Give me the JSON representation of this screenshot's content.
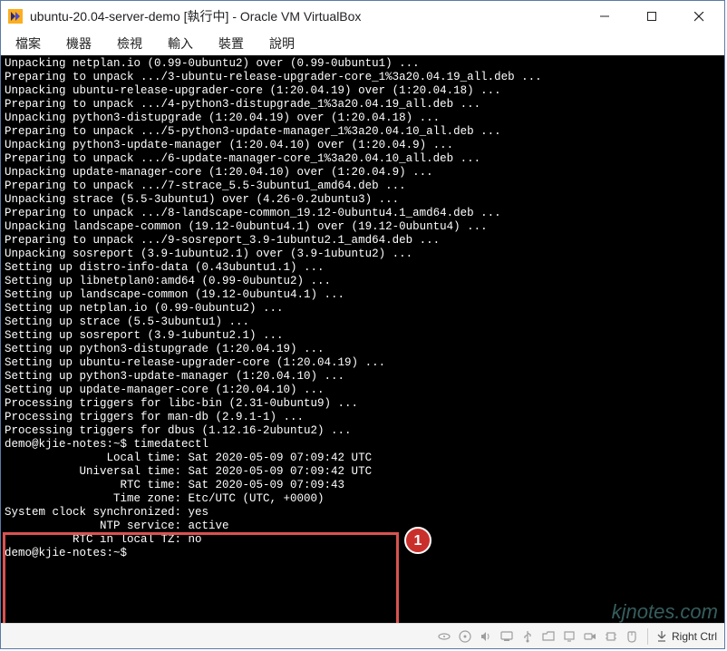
{
  "window": {
    "title": "ubuntu-20.04-server-demo [執行中] - Oracle VM VirtualBox"
  },
  "menu": {
    "file": "檔案",
    "machine": "機器",
    "view": "檢視",
    "input": "輸入",
    "devices": "裝置",
    "help": "說明"
  },
  "terminal_lines": [
    "Unpacking netplan.io (0.99-0ubuntu2) over (0.99-0ubuntu1) ...",
    "Preparing to unpack .../3-ubuntu-release-upgrader-core_1%3a20.04.19_all.deb ...",
    "Unpacking ubuntu-release-upgrader-core (1:20.04.19) over (1:20.04.18) ...",
    "Preparing to unpack .../4-python3-distupgrade_1%3a20.04.19_all.deb ...",
    "Unpacking python3-distupgrade (1:20.04.19) over (1:20.04.18) ...",
    "Preparing to unpack .../5-python3-update-manager_1%3a20.04.10_all.deb ...",
    "Unpacking python3-update-manager (1:20.04.10) over (1:20.04.9) ...",
    "Preparing to unpack .../6-update-manager-core_1%3a20.04.10_all.deb ...",
    "Unpacking update-manager-core (1:20.04.10) over (1:20.04.9) ...",
    "Preparing to unpack .../7-strace_5.5-3ubuntu1_amd64.deb ...",
    "Unpacking strace (5.5-3ubuntu1) over (4.26-0.2ubuntu3) ...",
    "Preparing to unpack .../8-landscape-common_19.12-0ubuntu4.1_amd64.deb ...",
    "Unpacking landscape-common (19.12-0ubuntu4.1) over (19.12-0ubuntu4) ...",
    "Preparing to unpack .../9-sosreport_3.9-1ubuntu2.1_amd64.deb ...",
    "Unpacking sosreport (3.9-1ubuntu2.1) over (3.9-1ubuntu2) ...",
    "Setting up distro-info-data (0.43ubuntu1.1) ...",
    "Setting up libnetplan0:amd64 (0.99-0ubuntu2) ...",
    "Setting up landscape-common (19.12-0ubuntu4.1) ...",
    "Setting up netplan.io (0.99-0ubuntu2) ...",
    "Setting up strace (5.5-3ubuntu1) ...",
    "Setting up sosreport (3.9-1ubuntu2.1) ...",
    "Setting up python3-distupgrade (1:20.04.19) ...",
    "Setting up ubuntu-release-upgrader-core (1:20.04.19) ...",
    "Setting up python3-update-manager (1:20.04.10) ...",
    "Setting up update-manager-core (1:20.04.10) ...",
    "Processing triggers for libc-bin (2.31-0ubuntu9) ...",
    "Processing triggers for man-db (2.9.1-1) ...",
    "Processing triggers for dbus (1.12.16-2ubuntu2) ...",
    "demo@kjie-notes:~$ timedatectl",
    "               Local time: Sat 2020-05-09 07:09:42 UTC",
    "           Universal time: Sat 2020-05-09 07:09:42 UTC",
    "                 RTC time: Sat 2020-05-09 07:09:43",
    "                Time zone: Etc/UTC (UTC, +0000)",
    "System clock synchronized: yes",
    "              NTP service: active",
    "          RTC in local TZ: no",
    "demo@kjie-notes:~$"
  ],
  "annotation": {
    "number": "1"
  },
  "statusbar": {
    "host_key": "Right Ctrl"
  },
  "watermark": "kjnotes.com"
}
